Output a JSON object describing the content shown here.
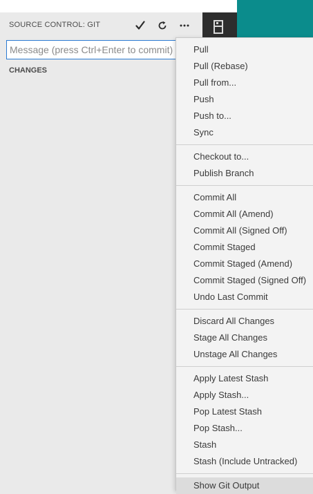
{
  "header": {
    "title": "SOURCE CONTROL: GIT",
    "commit_icon": "check-icon",
    "refresh_icon": "refresh-icon",
    "more_icon": "ellipsis-icon"
  },
  "commit_message": {
    "value": "",
    "placeholder": "Message (press Ctrl+Enter to commit)"
  },
  "changes": {
    "label": "CHANGES"
  },
  "menu": {
    "groups": [
      [
        "Pull",
        "Pull (Rebase)",
        "Pull from...",
        "Push",
        "Push to...",
        "Sync"
      ],
      [
        "Checkout to...",
        "Publish Branch"
      ],
      [
        "Commit All",
        "Commit All (Amend)",
        "Commit All (Signed Off)",
        "Commit Staged",
        "Commit Staged (Amend)",
        "Commit Staged (Signed Off)",
        "Undo Last Commit"
      ],
      [
        "Discard All Changes",
        "Stage All Changes",
        "Unstage All Changes"
      ],
      [
        "Apply Latest Stash",
        "Apply Stash...",
        "Pop Latest Stash",
        "Pop Stash...",
        "Stash",
        "Stash (Include Untracked)"
      ],
      [
        "Show Git Output"
      ]
    ],
    "hovered": "Show Git Output"
  },
  "colors": {
    "accent": "#2a7ad2",
    "teal_background": "#0b8c8c",
    "activity_bar": "#2d2d2d"
  }
}
